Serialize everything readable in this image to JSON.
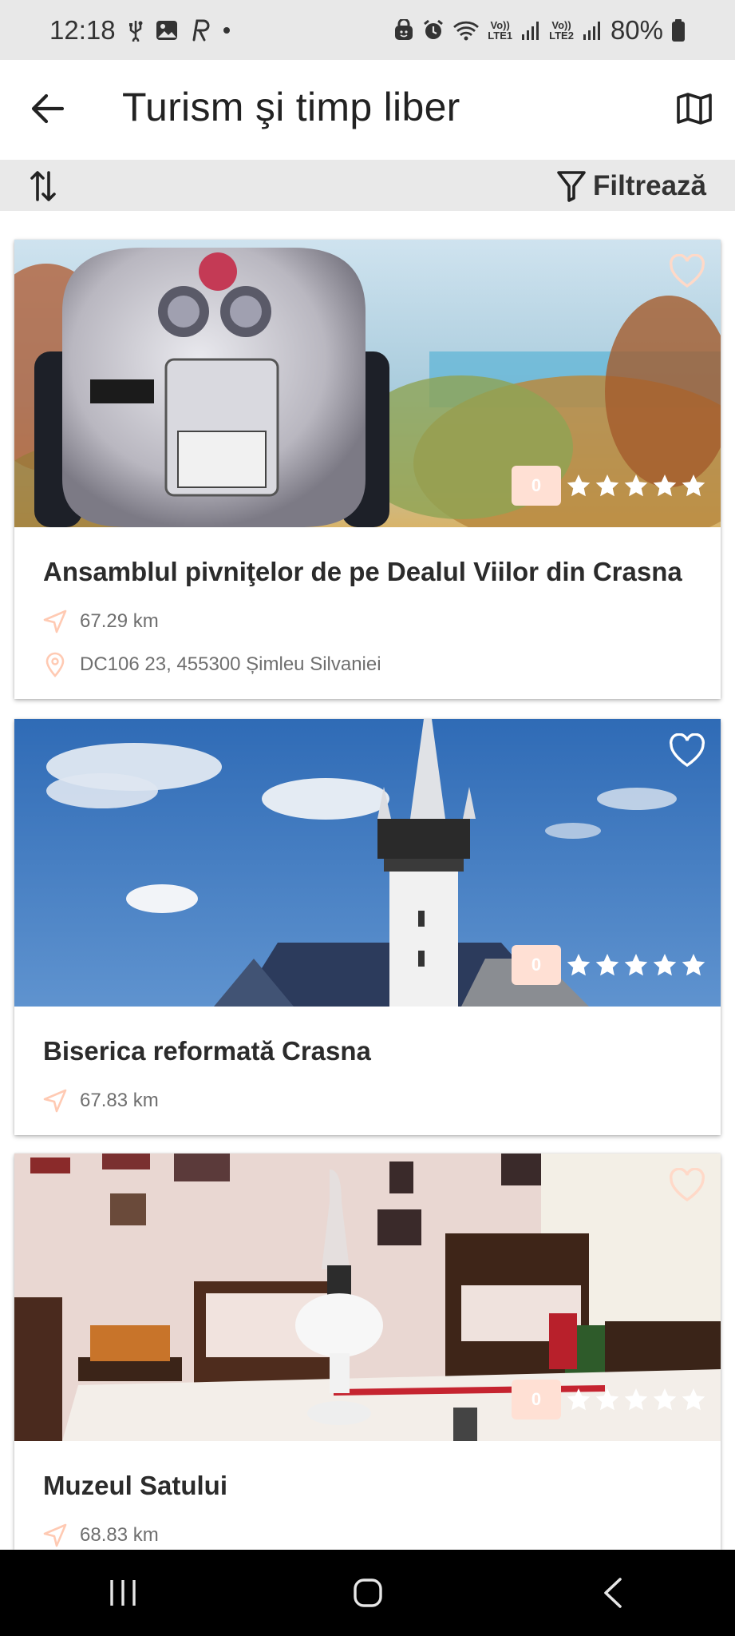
{
  "status_bar": {
    "time": "12:18",
    "battery": "80%",
    "sim1_label": "Vo))\nLTE1",
    "sim2_label": "Vo))\nLTE2",
    "icons": [
      "usb-icon",
      "gallery-icon",
      "r-app-icon",
      "dot-icon",
      "face-unlock-icon",
      "alarm-icon",
      "wifi-icon",
      "signal-icon",
      "battery-icon"
    ]
  },
  "header": {
    "title": "Turism şi timp liber",
    "back_icon": "arrow-left-icon",
    "map_icon": "map-icon"
  },
  "toolbar": {
    "sort_icon": "sort-icon",
    "filter_label": "Filtrează",
    "filter_icon": "filter-icon"
  },
  "theme": {
    "accent": "#ffcab3",
    "badge_bg": "#ffe0d4",
    "toolbar_bg": "#e9e9e9",
    "status_bg": "#e8e8e8",
    "nav_bg": "#000000"
  },
  "cards": [
    {
      "title": "Ansamblul pivniţelor de pe Dealul Viilor din Crasna",
      "distance": "67.29 km",
      "address": "DC106 23, 455300 Șimleu Silvaniei",
      "rating": "0",
      "stars_filled": 0,
      "stars_total": 5
    },
    {
      "title": "Biserica reformată Crasna",
      "distance": "67.83 km",
      "rating": "0",
      "stars_filled": 0,
      "stars_total": 5
    },
    {
      "title": "Muzeul Satului",
      "distance": "68.83 km",
      "rating": "0",
      "stars_filled": 0,
      "stars_total": 5
    }
  ],
  "nav": {
    "icons": [
      "recent-apps-icon",
      "home-icon",
      "back-icon"
    ]
  }
}
